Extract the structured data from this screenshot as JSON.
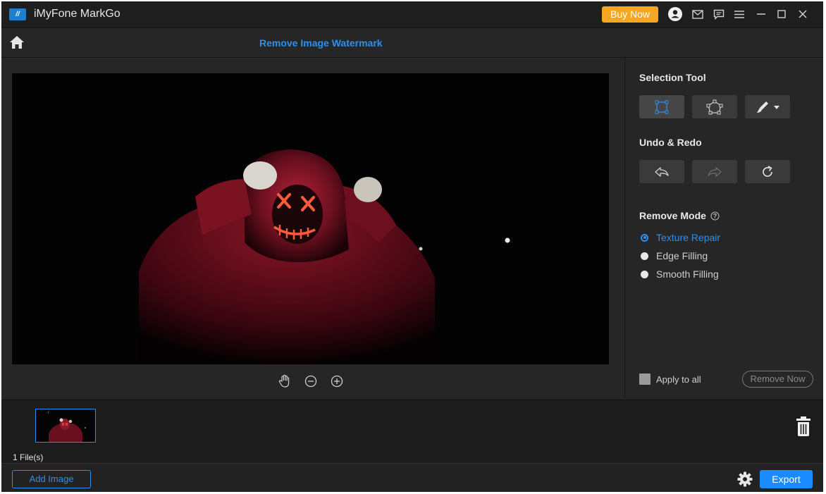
{
  "window": {
    "app_title": "iMyFone MarkGo",
    "logo_text": "//",
    "buy_now_label": "Buy Now",
    "icons": [
      "account-icon",
      "mail-icon",
      "feedback-icon",
      "menu-icon",
      "minimize-icon",
      "maximize-icon",
      "close-icon"
    ]
  },
  "toolbar": {
    "page_title": "Remove Image Watermark"
  },
  "panel": {
    "selection_tool_title": "Selection Tool",
    "undo_redo_title": "Undo & Redo",
    "remove_mode_title": "Remove Mode",
    "modes": [
      {
        "label": "Texture Repair",
        "selected": true
      },
      {
        "label": "Edge Filling",
        "selected": false
      },
      {
        "label": "Smooth Filling",
        "selected": false
      }
    ],
    "apply_to_all_label": "Apply to all",
    "remove_now_label": "Remove Now"
  },
  "files": {
    "count_label": "1 File(s)"
  },
  "footer": {
    "add_image_label": "Add Image",
    "export_label": "Export"
  },
  "colors": {
    "accent": "#2d8ff0",
    "buy_now": "#f5a623",
    "export": "#1a8cff",
    "background": "#262626"
  }
}
